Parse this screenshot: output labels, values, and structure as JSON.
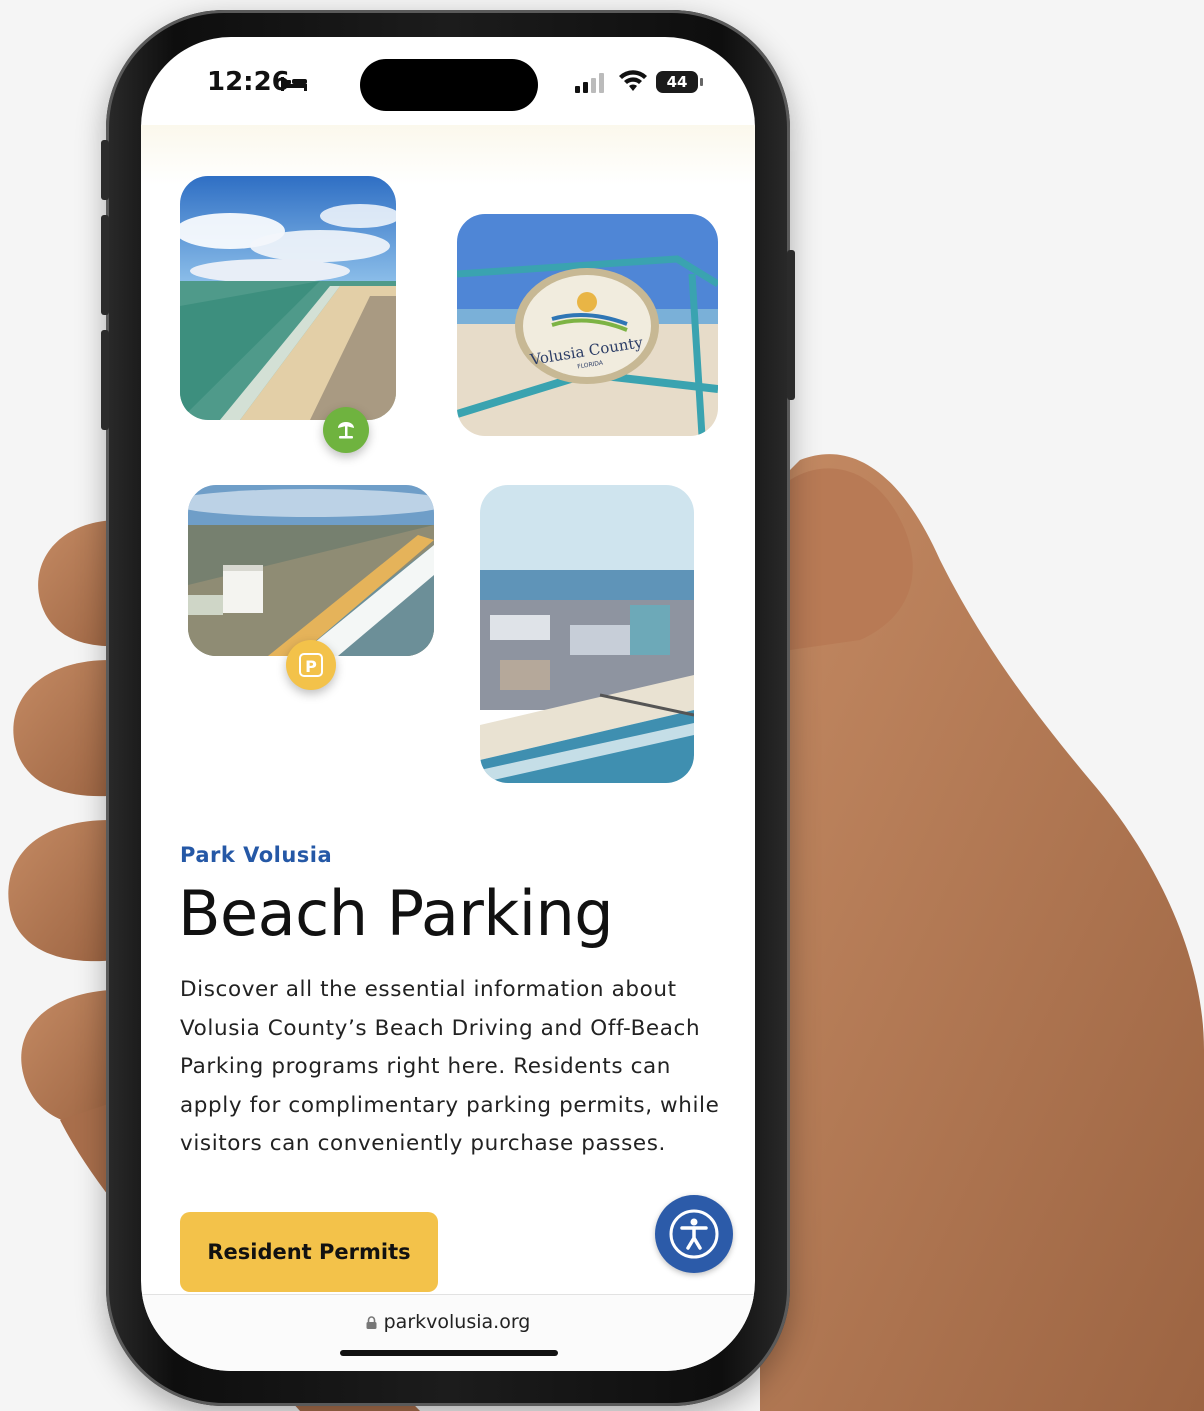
{
  "status_bar": {
    "time": "12:26",
    "battery": "44",
    "icons": [
      "bed-icon",
      "signal-icon",
      "wifi-icon",
      "battery-icon"
    ]
  },
  "gallery": {
    "photos": [
      "beach-aerial-photo",
      "volusia-county-sign-photo",
      "oceanfront-aerial-photo",
      "boardwalk-aerial-photo"
    ],
    "sign_text": "Volusia County",
    "sign_subtext": "FLORIDA",
    "badges": [
      {
        "icon": "palm-tree-icon",
        "color": "#6fb33f"
      },
      {
        "icon": "parking-icon",
        "label": "P",
        "color": "#f3c24a"
      }
    ]
  },
  "content": {
    "eyebrow": "Park Volusia",
    "title": "Beach Parking",
    "description": "Discover all the essential information about Volusia County’s Beach Driving and Off-Beach Parking programs right here. Residents can apply for complimentary parking permits, while visitors can conveniently purchase passes.",
    "cta_label": "Resident Permits"
  },
  "accessibility_button": {
    "icon": "accessibility-icon"
  },
  "browser": {
    "url": "parkvolusia.org"
  },
  "colors": {
    "brand_blue": "#2558a6",
    "accent_yellow": "#f3c24a",
    "badge_green": "#6fb33f",
    "a11y_blue": "#2c5ba9"
  }
}
